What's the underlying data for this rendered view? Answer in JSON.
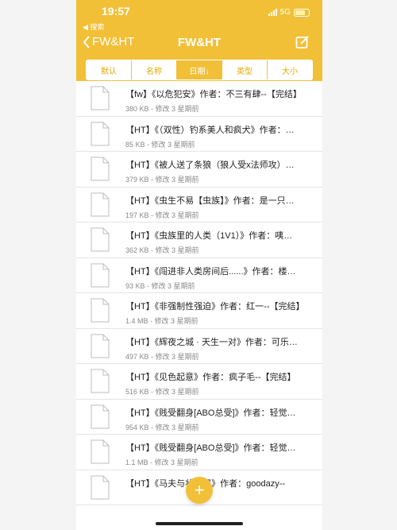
{
  "status": {
    "time": "19:57",
    "back_app": "◀ 搜索",
    "network": "5G"
  },
  "nav": {
    "back_label": "FW&HT",
    "title": "FW&HT"
  },
  "sort_tabs": [
    {
      "label": "默认"
    },
    {
      "label": "名称"
    },
    {
      "label": "日期↓"
    },
    {
      "label": "类型"
    },
    {
      "label": "大小"
    }
  ],
  "active_sort": "日期↓",
  "files": [
    {
      "name": "【fw】《以危犯安》作者：不三有肆--【完结】",
      "meta": "380 KB - 修改 3 星期前"
    },
    {
      "name": "【HT】《（双性）钓系美人和疯犬》作者：…",
      "meta": "85 KB - 修改 3 星期前"
    },
    {
      "name": "【HT】《被人送了条狼（狼人受x法师攻）…",
      "meta": "379 KB - 修改 3 星期前"
    },
    {
      "name": "【HT】《虫生不易【虫族】》作者：是一只…",
      "meta": "197 KB - 修改 3 星期前"
    },
    {
      "name": "【HT】《虫族里的人类（1V1）》作者：咦…",
      "meta": "362 KB - 修改 3 星期前"
    },
    {
      "name": "【HT】《闯进非人类房间后......》作者：楼…",
      "meta": "93 KB - 修改 3 星期前"
    },
    {
      "name": "【HT】《非强制性强迫》作者：红一--【完结】",
      "meta": "1.4 MB - 修改 3 星期前"
    },
    {
      "name": "【HT】《辉夜之城 · 天生一对》作者：可乐…",
      "meta": "497 KB - 修改 3 星期前"
    },
    {
      "name": "【HT】《见色起意》作者：疯子毛--【完结】",
      "meta": "516 KB - 修改 3 星期前"
    },
    {
      "name": "【HT】《贱受翻身[ABO总受]》作者：轻觉…",
      "meta": "954 KB - 修改 3 星期前"
    },
    {
      "name": "【HT】《贱受翻身[ABO总受]》作者：轻觉…",
      "meta": "1.1 MB - 修改 3 星期前"
    },
    {
      "name": "【HT】《马夫与状元郎》作者：goodazy--",
      "meta": ""
    }
  ],
  "fab_label": "+",
  "colors": {
    "accent": "#f2c037"
  }
}
